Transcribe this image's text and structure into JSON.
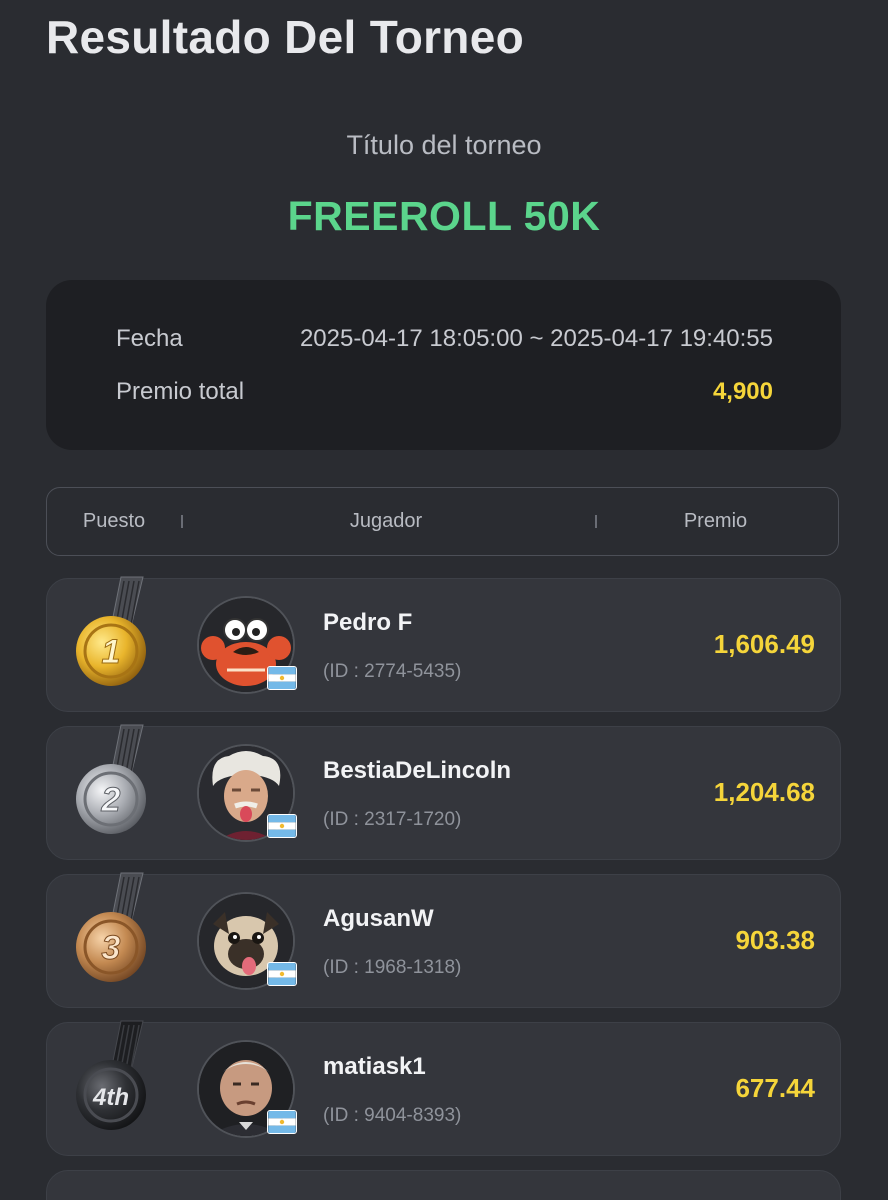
{
  "header": {
    "title": "Resultado Del Torneo"
  },
  "tournament": {
    "subtitle": "Título del torneo",
    "name": "FREEROLL 50K"
  },
  "info": {
    "date_label": "Fecha",
    "date_value": "2025-04-17 18:05:00 ~ 2025-04-17 19:40:55",
    "prize_label": "Premio total",
    "prize_value": "4,900"
  },
  "table": {
    "col_position": "Puesto",
    "col_player": "Jugador",
    "col_prize": "Premio"
  },
  "results": [
    {
      "position": "1",
      "medal": "gold-medal-icon",
      "avatar": "crab-avatar",
      "name": "Pedro F",
      "id": "(ID : 2774-5435)",
      "prize": "1,606.49",
      "flag": "argentina-flag-icon"
    },
    {
      "position": "2",
      "medal": "silver-medal-icon",
      "avatar": "einstein-avatar",
      "name": "BestiaDeLincoln",
      "id": "(ID : 2317-1720)",
      "prize": "1,204.68",
      "flag": "argentina-flag-icon"
    },
    {
      "position": "3",
      "medal": "bronze-medal-icon",
      "avatar": "pug-avatar",
      "name": "AgusanW",
      "id": "(ID : 1968-1318)",
      "prize": "903.38",
      "flag": "argentina-flag-icon"
    },
    {
      "position": "4th",
      "medal": "black-medal-icon",
      "avatar": "churchill-avatar",
      "name": "matiask1",
      "id": "(ID : 9404-8393)",
      "prize": "677.44",
      "flag": "argentina-flag-icon"
    }
  ],
  "colors": {
    "accent_green": "#5bd58c",
    "prize_gold": "#f5d53a",
    "background": "#2a2c31",
    "card": "#34363c"
  }
}
